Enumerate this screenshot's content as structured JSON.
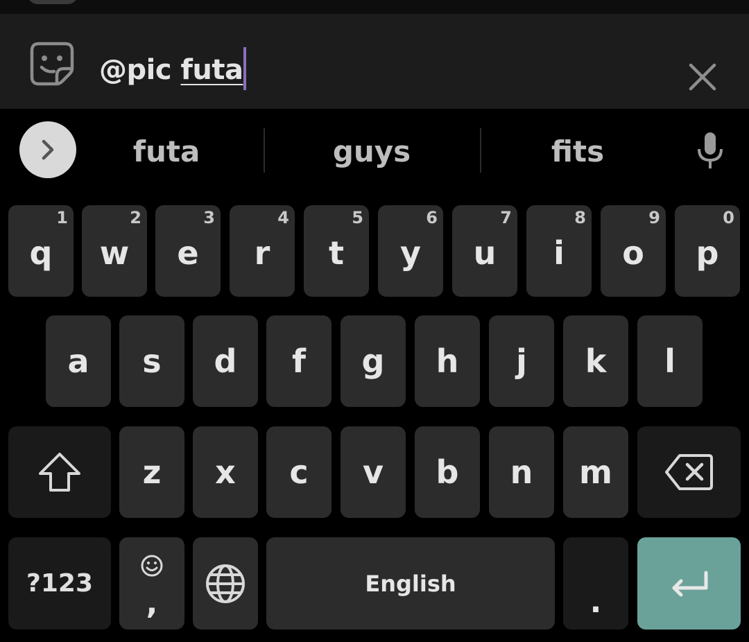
{
  "input": {
    "prefix": "@pic ",
    "word": "futa"
  },
  "suggestions": [
    "futa",
    "guys",
    "fits"
  ],
  "keyboard": {
    "row1": [
      {
        "letter": "q",
        "hint": "1"
      },
      {
        "letter": "w",
        "hint": "2"
      },
      {
        "letter": "e",
        "hint": "3"
      },
      {
        "letter": "r",
        "hint": "4"
      },
      {
        "letter": "t",
        "hint": "5"
      },
      {
        "letter": "y",
        "hint": "6"
      },
      {
        "letter": "u",
        "hint": "7"
      },
      {
        "letter": "i",
        "hint": "8"
      },
      {
        "letter": "o",
        "hint": "9"
      },
      {
        "letter": "p",
        "hint": "0"
      }
    ],
    "row2": [
      "a",
      "s",
      "d",
      "f",
      "g",
      "h",
      "j",
      "k",
      "l"
    ],
    "row3": [
      "z",
      "x",
      "c",
      "v",
      "b",
      "n",
      "m"
    ],
    "symbols_label": "?123",
    "comma_label": ",",
    "space_label": "English",
    "period_label": "."
  },
  "colors": {
    "accent_caret": "#8a6fbf",
    "enter_key": "#6aa29a",
    "key_bg": "#2c2c2c",
    "special_key_bg": "#1a1a1a"
  },
  "icons": [
    "sticker-icon",
    "close-icon",
    "chevron-right-icon",
    "microphone-icon",
    "shift-icon",
    "backspace-icon",
    "emoji-icon",
    "globe-icon",
    "enter-icon"
  ]
}
